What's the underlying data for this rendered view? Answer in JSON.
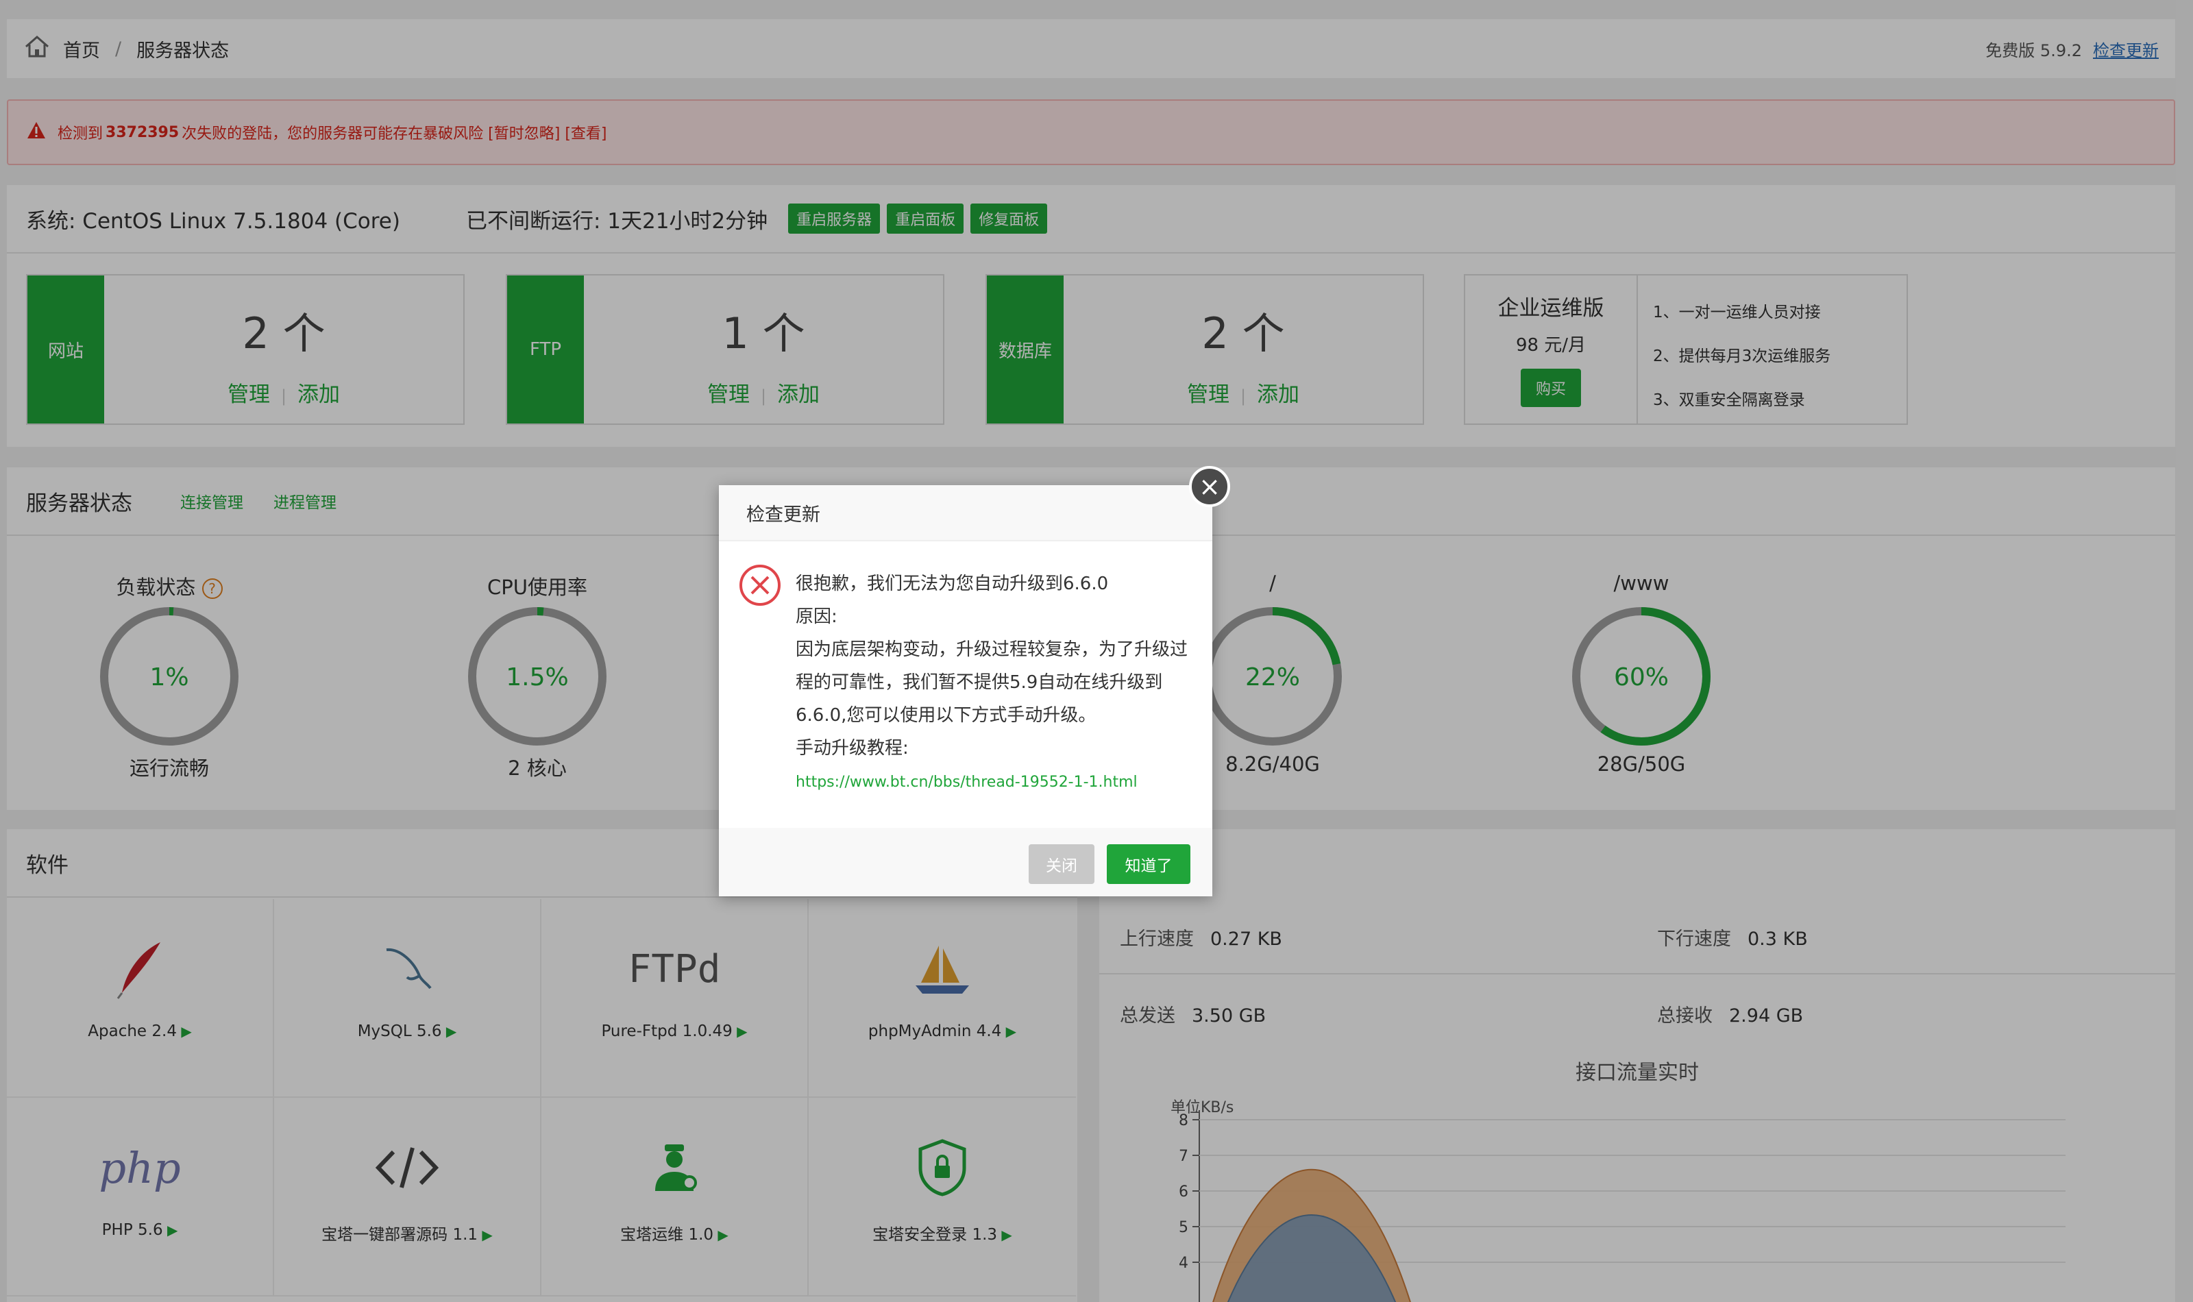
{
  "breadcrumb": {
    "home": "首页",
    "current": "服务器状态",
    "version": "免费版 5.9.2",
    "check_update": "检查更新"
  },
  "alert": {
    "prefix": "检测到",
    "count": "3372395",
    "message": "次失败的登陆，您的服务器可能存在暴破风险 [暂时忽略] [查看]"
  },
  "system": {
    "os": "系统: CentOS Linux 7.5.1804 (Core)",
    "uptime": "已不间断运行: 1天21小时2分钟",
    "btn_restart_server": "重启服务器",
    "btn_restart_panel": "重启面板",
    "btn_repair_panel": "修复面板"
  },
  "stats": [
    {
      "label": "网站",
      "count": "2 个",
      "manage": "管理",
      "add": "添加"
    },
    {
      "label": "FTP",
      "count": "1 个",
      "manage": "管理",
      "add": "添加"
    },
    {
      "label": "数据库",
      "count": "2 个",
      "manage": "管理",
      "add": "添加"
    }
  ],
  "enterprise": {
    "title": "企业运维版",
    "price": "98 元/月",
    "buy": "购买",
    "features": [
      "1、一对一运维人员对接",
      "2、提供每月3次运维服务",
      "3、双重安全隔离登录"
    ]
  },
  "server_status": {
    "title": "服务器状态",
    "link_conn": "连接管理",
    "link_proc": "进程管理",
    "gauges": [
      {
        "title": "负载状态",
        "value": "1%",
        "percent": 1,
        "bottom": "运行流畅",
        "help": "?"
      },
      {
        "title": "CPU使用率",
        "value": "1.5%",
        "percent": 1.5,
        "bottom": "2 核心"
      },
      {
        "title": "/",
        "value": "22%",
        "percent": 22,
        "bottom": "8.2G/40G"
      },
      {
        "title": "/www",
        "value": "60%",
        "percent": 60,
        "bottom": "28G/50G"
      }
    ]
  },
  "software": {
    "title": "软件",
    "items": [
      {
        "name": "Apache 2.4",
        "icon": "feather-icon"
      },
      {
        "name": "MySQL 5.6",
        "icon": "dolphin-icon"
      },
      {
        "name": "Pure-Ftpd 1.0.49",
        "icon": "ftpd-icon",
        "icon_text": "FTPd"
      },
      {
        "name": "phpMyAdmin 4.4",
        "icon": "sailboat-icon"
      },
      {
        "name": "PHP 5.6",
        "icon": "php-icon",
        "icon_text": "php"
      },
      {
        "name": "宝塔一键部署源码 1.1",
        "icon": "code-icon"
      },
      {
        "name": "宝塔运维 1.0",
        "icon": "operator-icon"
      },
      {
        "name": "宝塔安全登录 1.3",
        "icon": "shield-lock-icon"
      }
    ]
  },
  "network": {
    "up_label": "上行速度",
    "up_value": "0.27 KB",
    "down_label": "下行速度",
    "down_value": "0.3 KB",
    "sent_label": "总发送",
    "sent_value": "3.50 GB",
    "recv_label": "总接收",
    "recv_value": "2.94 GB",
    "chart_title": "接口流量实时",
    "unit": "单位KB/s"
  },
  "chart_data": {
    "type": "area",
    "title": "接口流量实时",
    "ylabel": "单位KB/s",
    "y_ticks": [
      8,
      7,
      6,
      5,
      4
    ],
    "series": [
      {
        "values": [
          0,
          7.2,
          0
        ]
      },
      {
        "values": [
          0,
          5.5,
          0
        ]
      }
    ]
  },
  "dialog": {
    "title": "检查更新",
    "line1": "很抱歉，我们无法为您自动升级到6.6.0",
    "reason_label": "原因:",
    "reason": "因为底层架构变动，升级过程较复杂，为了升级过程的可靠性，我们暂不提供5.9自动在线升级到6.6.0,您可以使用以下方式手动升级。",
    "tutorial_label": "手动升级教程:",
    "link": "https://www.bt.cn/bbs/thread-19552-1-1.html",
    "btn_close": "关闭",
    "btn_ok": "知道了"
  },
  "colors": {
    "accent": "#20a53a",
    "alert": "#d9251b",
    "ring_bg": "#a0a0a0"
  }
}
